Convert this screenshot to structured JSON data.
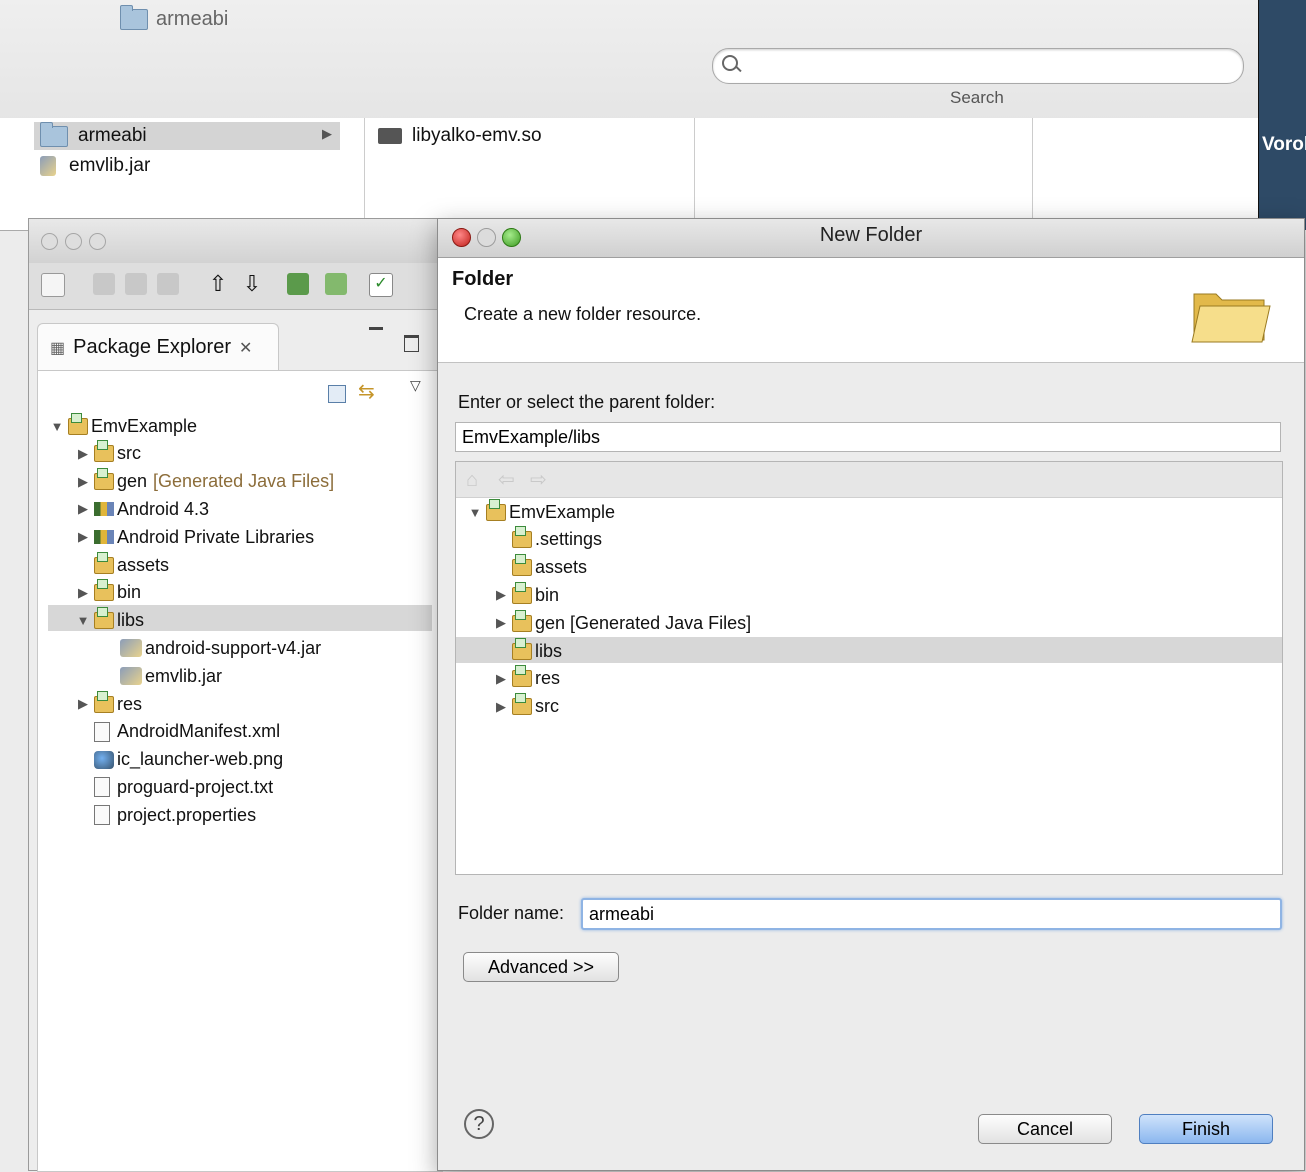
{
  "finder": {
    "title": "armeabi",
    "search_label": "Search",
    "column1": [
      {
        "label": "armeabi",
        "type": "folder",
        "selected": true
      },
      {
        "label": "emvlib.jar",
        "type": "jar"
      }
    ],
    "column2": [
      {
        "label": "libyalko-emv.so",
        "type": "file"
      }
    ],
    "right_window_text": "Vorol"
  },
  "eclipse": {
    "panel_title": "Package Explorer",
    "tree": [
      {
        "label": "EmvExample",
        "indent": 0,
        "toggle": "open",
        "icon": "project"
      },
      {
        "label": "src",
        "indent": 1,
        "toggle": "closed",
        "icon": "srcfolder"
      },
      {
        "label": "gen",
        "suffix": "[Generated Java Files]",
        "indent": 1,
        "toggle": "closed",
        "icon": "srcfolder"
      },
      {
        "label": "Android 4.3",
        "indent": 1,
        "toggle": "closed",
        "icon": "library"
      },
      {
        "label": "Android Private Libraries",
        "indent": 1,
        "toggle": "closed",
        "icon": "library"
      },
      {
        "label": "assets",
        "indent": 1,
        "toggle": "none",
        "icon": "folder"
      },
      {
        "label": "bin",
        "indent": 1,
        "toggle": "closed",
        "icon": "folder"
      },
      {
        "label": "libs",
        "indent": 1,
        "toggle": "open",
        "icon": "folder",
        "selected": true
      },
      {
        "label": "android-support-v4.jar",
        "indent": 2,
        "toggle": "none",
        "icon": "jar"
      },
      {
        "label": "emvlib.jar",
        "indent": 2,
        "toggle": "none",
        "icon": "jar"
      },
      {
        "label": "res",
        "indent": 1,
        "toggle": "closed",
        "icon": "folder"
      },
      {
        "label": "AndroidManifest.xml",
        "indent": 1,
        "toggle": "none",
        "icon": "file"
      },
      {
        "label": "ic_launcher-web.png",
        "indent": 1,
        "toggle": "none",
        "icon": "image"
      },
      {
        "label": "proguard-project.txt",
        "indent": 1,
        "toggle": "none",
        "icon": "file"
      },
      {
        "label": "project.properties",
        "indent": 1,
        "toggle": "none",
        "icon": "file"
      }
    ]
  },
  "dialog": {
    "title": "New Folder",
    "header_title": "Folder",
    "header_desc": "Create a new folder resource.",
    "parent_label": "Enter or select the parent folder:",
    "parent_value": "EmvExample/libs",
    "tree": [
      {
        "label": "EmvExample",
        "indent": 0,
        "toggle": "open"
      },
      {
        "label": ".settings",
        "indent": 1,
        "toggle": "none"
      },
      {
        "label": "assets",
        "indent": 1,
        "toggle": "none"
      },
      {
        "label": "bin",
        "indent": 1,
        "toggle": "closed"
      },
      {
        "label": "gen [Generated Java Files]",
        "indent": 1,
        "toggle": "closed"
      },
      {
        "label": "libs",
        "indent": 1,
        "toggle": "none",
        "selected": true
      },
      {
        "label": "res",
        "indent": 1,
        "toggle": "closed"
      },
      {
        "label": "src",
        "indent": 1,
        "toggle": "closed"
      }
    ],
    "folder_name_label": "Folder name:",
    "folder_name_value": "armeabi",
    "advanced_label": "Advanced >>",
    "cancel_label": "Cancel",
    "finish_label": "Finish",
    "help_glyph": "?"
  },
  "colors": {
    "selection": "#d7d7d7",
    "focus": "#8fb4e4",
    "default_button": "#8bb7ef"
  }
}
